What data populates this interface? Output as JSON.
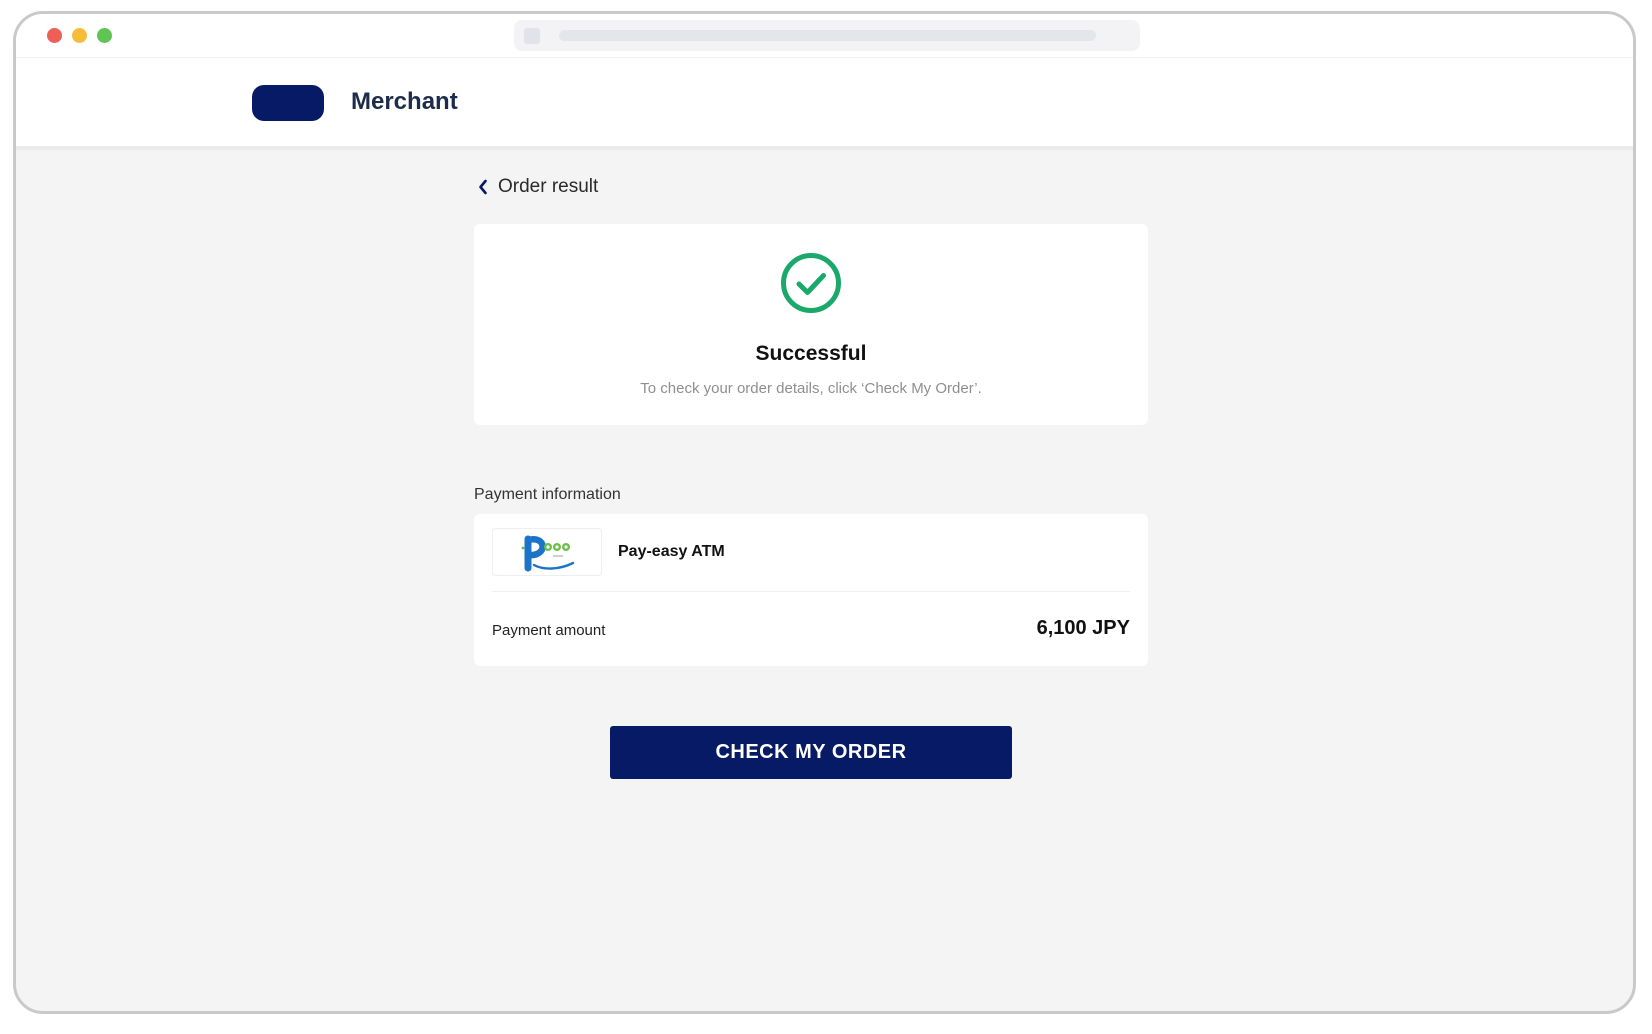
{
  "header": {
    "merchant_name": "Merchant"
  },
  "nav": {
    "back_label": "Order result"
  },
  "result": {
    "title": "Successful",
    "message": "To check your order details, click ‘Check My Order’."
  },
  "payment": {
    "section_label": "Payment information",
    "method_name": "Pay-easy ATM",
    "amount_label": "Payment amount",
    "amount_value": "6,100 JPY"
  },
  "actions": {
    "check_order_label": "CHECK MY ORDER"
  },
  "icons": {
    "back": "chevron-left-icon",
    "status": "check-circle-icon",
    "method_logo": "pay-easy-logo"
  },
  "colors": {
    "brand": "#061a66",
    "success": "#1aa86b",
    "background": "#f4f4f4"
  }
}
